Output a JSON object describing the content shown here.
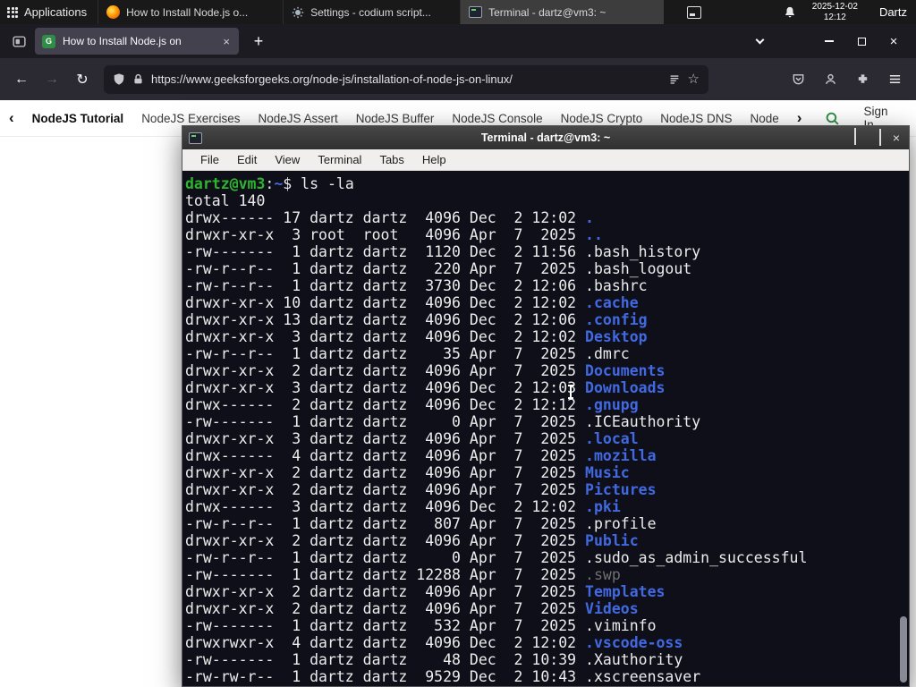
{
  "taskbar": {
    "applications": "Applications",
    "windows": [
      {
        "title": "How to Install Node.js o...",
        "icon": "firefox"
      },
      {
        "title": "Settings - codium script...",
        "icon": "settings-gear"
      },
      {
        "title": "Terminal - dartz@vm3: ~",
        "icon": "terminal",
        "active": true
      }
    ],
    "clock_date": "2025-12-02",
    "clock_time": "12:12",
    "user": "Dartz"
  },
  "browser": {
    "tab_title": "How to Install Node.js on",
    "tab_close": "×",
    "new_tab": "+",
    "url": "https://www.geeksforgeeks.org/node-js/installation-of-node-js-on-linux/",
    "back": "←",
    "forward": "→",
    "reload": "↻"
  },
  "site_nav": {
    "scroll_left": "‹",
    "scroll_right": "›",
    "items": [
      "NodeJS Tutorial",
      "NodeJS Exercises",
      "NodeJS Assert",
      "NodeJS Buffer",
      "NodeJS Console",
      "NodeJS Crypto",
      "NodeJS DNS",
      "Node"
    ],
    "sign_in": "Sign In"
  },
  "terminal": {
    "title": "Terminal - dartz@vm3: ~",
    "menu": [
      "File",
      "Edit",
      "View",
      "Terminal",
      "Tabs",
      "Help"
    ],
    "prompt_user_host": "dartz@vm3",
    "prompt_separator": ":",
    "prompt_cwd": "~",
    "prompt_symbol": "$",
    "command": "ls -la",
    "total_line": "total 140",
    "listing": [
      {
        "perm": "drwx------",
        "links": "17",
        "owner": "dartz",
        "group": "dartz",
        "size": "4096",
        "date": "Dec  2 12:02",
        "name": ".",
        "cls": "dir"
      },
      {
        "perm": "drwxr-xr-x",
        "links": "3",
        "owner": "root",
        "group": "root",
        "size": "4096",
        "date": "Apr  7  2025",
        "name": "..",
        "cls": "dir"
      },
      {
        "perm": "-rw-------",
        "links": "1",
        "owner": "dartz",
        "group": "dartz",
        "size": "1120",
        "date": "Dec  2 11:56",
        "name": ".bash_history",
        "cls": "file"
      },
      {
        "perm": "-rw-r--r--",
        "links": "1",
        "owner": "dartz",
        "group": "dartz",
        "size": "220",
        "date": "Apr  7  2025",
        "name": ".bash_logout",
        "cls": "file"
      },
      {
        "perm": "-rw-r--r--",
        "links": "1",
        "owner": "dartz",
        "group": "dartz",
        "size": "3730",
        "date": "Dec  2 12:06",
        "name": ".bashrc",
        "cls": "file"
      },
      {
        "perm": "drwxr-xr-x",
        "links": "10",
        "owner": "dartz",
        "group": "dartz",
        "size": "4096",
        "date": "Dec  2 12:02",
        "name": ".cache",
        "cls": "dir"
      },
      {
        "perm": "drwxr-xr-x",
        "links": "13",
        "owner": "dartz",
        "group": "dartz",
        "size": "4096",
        "date": "Dec  2 12:06",
        "name": ".config",
        "cls": "dir"
      },
      {
        "perm": "drwxr-xr-x",
        "links": "3",
        "owner": "dartz",
        "group": "dartz",
        "size": "4096",
        "date": "Dec  2 12:02",
        "name": "Desktop",
        "cls": "dir"
      },
      {
        "perm": "-rw-r--r--",
        "links": "1",
        "owner": "dartz",
        "group": "dartz",
        "size": "35",
        "date": "Apr  7  2025",
        "name": ".dmrc",
        "cls": "file"
      },
      {
        "perm": "drwxr-xr-x",
        "links": "2",
        "owner": "dartz",
        "group": "dartz",
        "size": "4096",
        "date": "Apr  7  2025",
        "name": "Documents",
        "cls": "dir"
      },
      {
        "perm": "drwxr-xr-x",
        "links": "3",
        "owner": "dartz",
        "group": "dartz",
        "size": "4096",
        "date": "Dec  2 12:03",
        "name": "Downloads",
        "cls": "dir"
      },
      {
        "perm": "drwx------",
        "links": "2",
        "owner": "dartz",
        "group": "dartz",
        "size": "4096",
        "date": "Dec  2 12:12",
        "name": ".gnupg",
        "cls": "dir"
      },
      {
        "perm": "-rw-------",
        "links": "1",
        "owner": "dartz",
        "group": "dartz",
        "size": "0",
        "date": "Apr  7  2025",
        "name": ".ICEauthority",
        "cls": "file"
      },
      {
        "perm": "drwxr-xr-x",
        "links": "3",
        "owner": "dartz",
        "group": "dartz",
        "size": "4096",
        "date": "Apr  7  2025",
        "name": ".local",
        "cls": "dir"
      },
      {
        "perm": "drwx------",
        "links": "4",
        "owner": "dartz",
        "group": "dartz",
        "size": "4096",
        "date": "Apr  7  2025",
        "name": ".mozilla",
        "cls": "dir"
      },
      {
        "perm": "drwxr-xr-x",
        "links": "2",
        "owner": "dartz",
        "group": "dartz",
        "size": "4096",
        "date": "Apr  7  2025",
        "name": "Music",
        "cls": "dir"
      },
      {
        "perm": "drwxr-xr-x",
        "links": "2",
        "owner": "dartz",
        "group": "dartz",
        "size": "4096",
        "date": "Apr  7  2025",
        "name": "Pictures",
        "cls": "dir"
      },
      {
        "perm": "drwx------",
        "links": "3",
        "owner": "dartz",
        "group": "dartz",
        "size": "4096",
        "date": "Dec  2 12:02",
        "name": ".pki",
        "cls": "dir"
      },
      {
        "perm": "-rw-r--r--",
        "links": "1",
        "owner": "dartz",
        "group": "dartz",
        "size": "807",
        "date": "Apr  7  2025",
        "name": ".profile",
        "cls": "file"
      },
      {
        "perm": "drwxr-xr-x",
        "links": "2",
        "owner": "dartz",
        "group": "dartz",
        "size": "4096",
        "date": "Apr  7  2025",
        "name": "Public",
        "cls": "dir"
      },
      {
        "perm": "-rw-r--r--",
        "links": "1",
        "owner": "dartz",
        "group": "dartz",
        "size": "0",
        "date": "Apr  7  2025",
        "name": ".sudo_as_admin_successful",
        "cls": "file"
      },
      {
        "perm": "-rw-------",
        "links": "1",
        "owner": "dartz",
        "group": "dartz",
        "size": "12288",
        "date": "Apr  7  2025",
        "name": ".swp",
        "cls": "dim"
      },
      {
        "perm": "drwxr-xr-x",
        "links": "2",
        "owner": "dartz",
        "group": "dartz",
        "size": "4096",
        "date": "Apr  7  2025",
        "name": "Templates",
        "cls": "dir"
      },
      {
        "perm": "drwxr-xr-x",
        "links": "2",
        "owner": "dartz",
        "group": "dartz",
        "size": "4096",
        "date": "Apr  7  2025",
        "name": "Videos",
        "cls": "dir"
      },
      {
        "perm": "-rw-------",
        "links": "1",
        "owner": "dartz",
        "group": "dartz",
        "size": "532",
        "date": "Apr  7  2025",
        "name": ".viminfo",
        "cls": "file"
      },
      {
        "perm": "drwxrwxr-x",
        "links": "4",
        "owner": "dartz",
        "group": "dartz",
        "size": "4096",
        "date": "Dec  2 12:02",
        "name": ".vscode-oss",
        "cls": "dir"
      },
      {
        "perm": "-rw-------",
        "links": "1",
        "owner": "dartz",
        "group": "dartz",
        "size": "48",
        "date": "Dec  2 10:39",
        "name": ".Xauthority",
        "cls": "file"
      },
      {
        "perm": "-rw-rw-r--",
        "links": "1",
        "owner": "dartz",
        "group": "dartz",
        "size": "9529",
        "date": "Dec  2 10:43",
        "name": ".xscreensaver",
        "cls": "file"
      }
    ]
  },
  "colors": {
    "prompt_green": "#2db52d",
    "dir_blue": "#4169e1",
    "terminal_bg": "#0f0f1a",
    "gfg_green": "#2f8d46",
    "firefox_chrome": "#2b2a33"
  }
}
